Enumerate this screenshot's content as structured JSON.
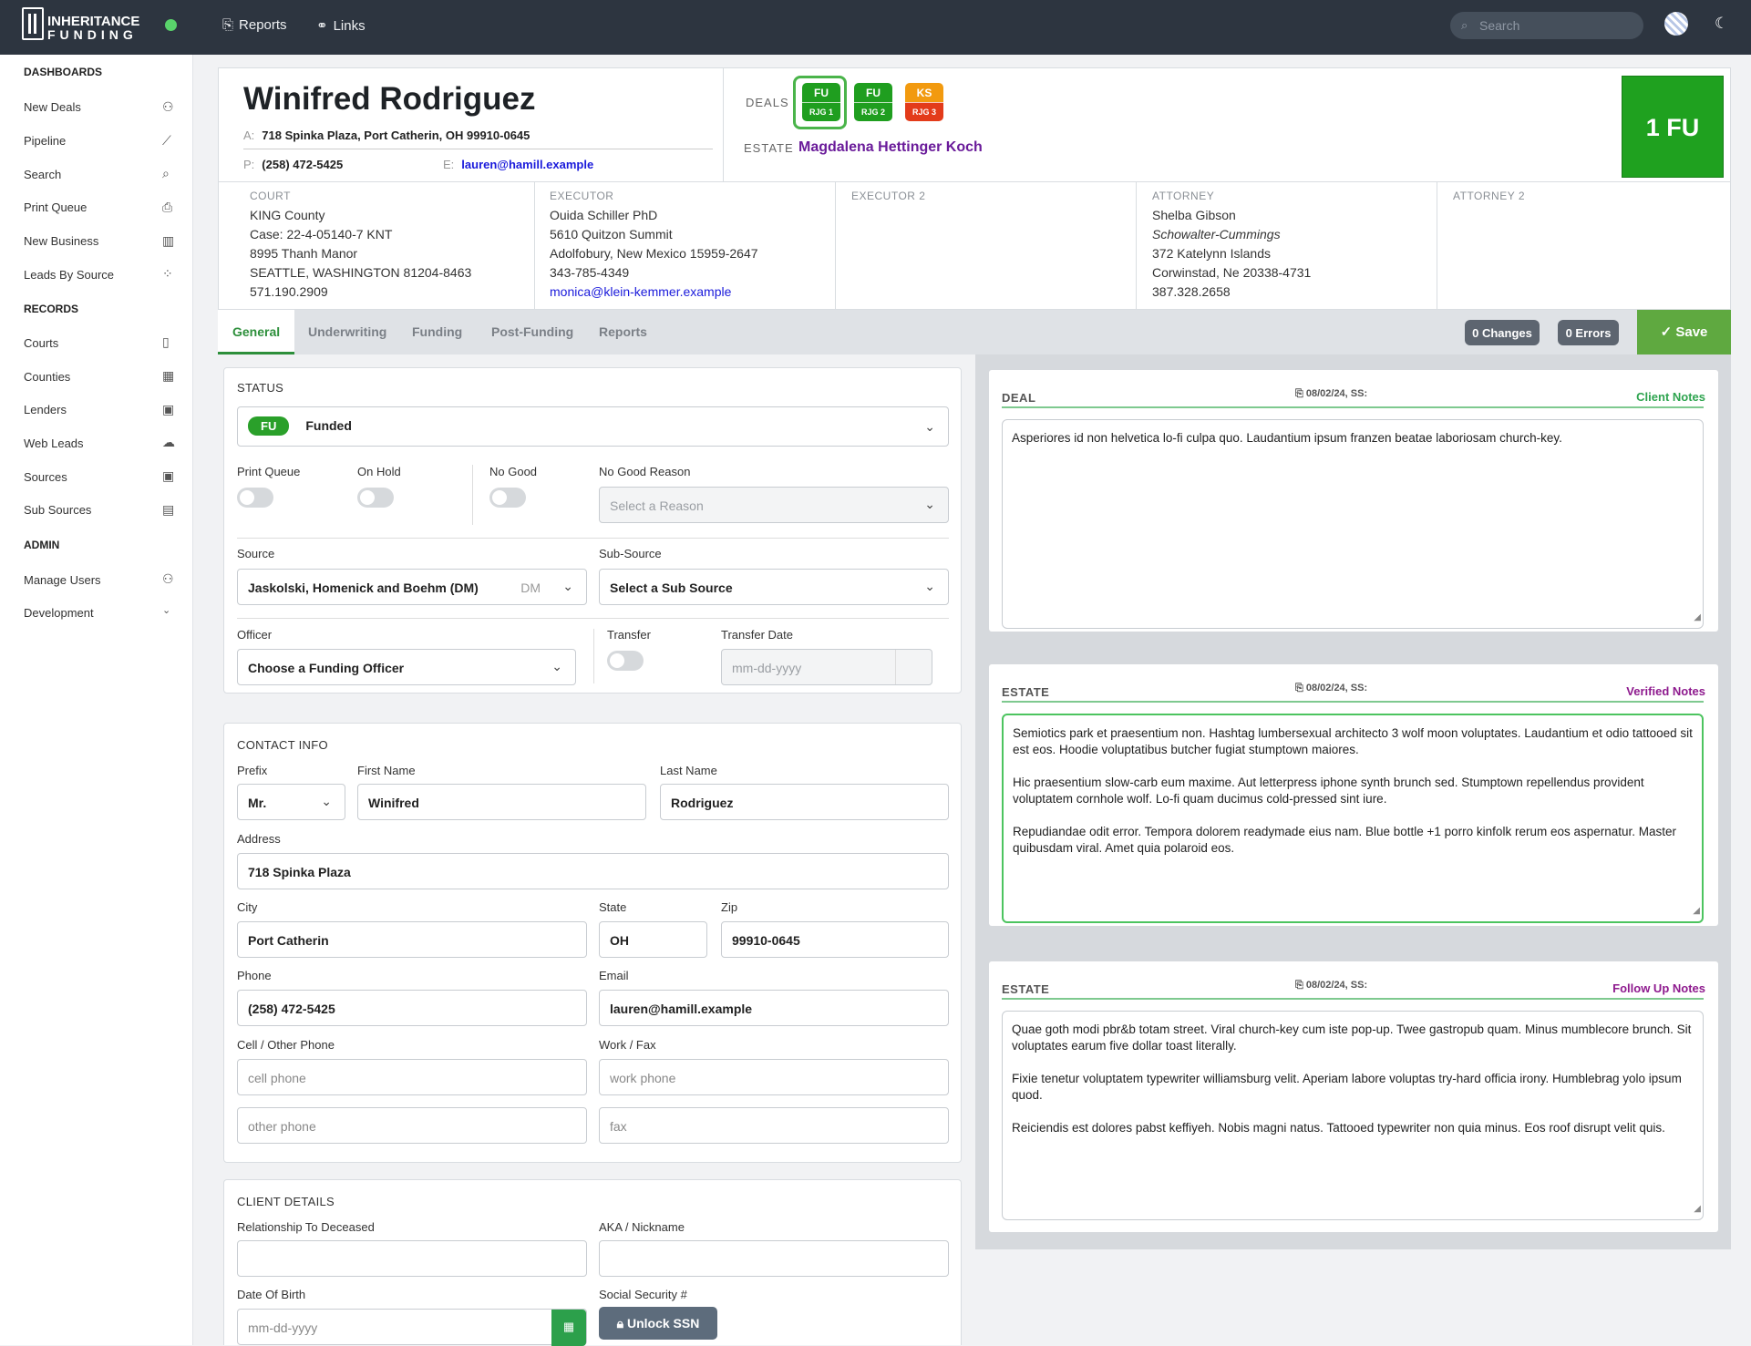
{
  "app": {
    "logo_line1": "INHERITANCE",
    "logo_line2": "FUNDING"
  },
  "topnav": {
    "reports": "Reports",
    "links": "Links",
    "search_placeholder": "Search"
  },
  "sidebar": {
    "dashboards_title": "DASHBOARDS",
    "dashboards": [
      "New Deals",
      "Pipeline",
      "Search",
      "Print Queue",
      "New Business",
      "Leads By Source"
    ],
    "records_title": "RECORDS",
    "records": [
      "Courts",
      "Counties",
      "Lenders",
      "Web Leads",
      "Sources",
      "Sub Sources"
    ],
    "admin_title": "ADMIN",
    "admin": [
      "Manage Users",
      "Development"
    ]
  },
  "header": {
    "name": "Winifred Rodriguez",
    "address_label": "A:",
    "address": "718 Spinka Plaza, Port Catherin, OH 99910-0645",
    "phone_label": "P:",
    "phone": "(258) 472-5425",
    "email_label": "E:",
    "email": "lauren@hamill.example",
    "deals_label": "DEALS",
    "deals": [
      {
        "code": "FU",
        "sub": "RJG 1",
        "top_color": "#1f9e1f",
        "bottom_color": "#1f9e1f"
      },
      {
        "code": "FU",
        "sub": "RJG 2",
        "top_color": "#1f9e1f",
        "bottom_color": "#1f9e1f"
      },
      {
        "code": "KS",
        "sub": "RJG 3",
        "top_color": "#f29a0f",
        "bottom_color": "#e33b1a"
      }
    ],
    "estate_label": "ESTATE",
    "estate": "Magdalena Hettinger Koch",
    "status_box": "1 FU"
  },
  "info": {
    "court": {
      "title": "COURT",
      "lines": [
        "KING County",
        "Case: 22-4-05140-7 KNT",
        "8995 Thanh Manor",
        "SEATTLE, WASHINGTON 81204-8463",
        "571.190.2909"
      ]
    },
    "executor": {
      "title": "EXECUTOR",
      "lines": [
        "Ouida Schiller PhD",
        "5610 Quitzon Summit",
        "Adolfobury, New Mexico 15959-2647",
        "343-785-4349"
      ],
      "email": "monica@klein-kemmer.example"
    },
    "executor2": {
      "title": "EXECUTOR 2"
    },
    "attorney": {
      "title": "ATTORNEY",
      "name": "Shelba Gibson",
      "firm": "Schowalter-Cummings",
      "lines": [
        "372 Katelynn Islands",
        "Corwinstad, Ne 20338-4731",
        "387.328.2658"
      ]
    },
    "attorney2": {
      "title": "ATTORNEY 2"
    }
  },
  "tabs": [
    "General",
    "Underwriting",
    "Funding",
    "Post-Funding",
    "Reports"
  ],
  "changes_badge": "0 Changes",
  "errors_badge": "0 Errors",
  "save_label": "Save",
  "status": {
    "title": "STATUS",
    "pill": "FU",
    "value": "Funded",
    "print_queue": "Print Queue",
    "on_hold": "On Hold",
    "no_good": "No Good",
    "no_good_reason": "No Good Reason",
    "no_good_reason_placeholder": "Select a Reason",
    "source_label": "Source",
    "source": "Jaskolski, Homenick and Boehm (DM)",
    "source_code": "DM",
    "subsource_label": "Sub-Source",
    "subsource": "Select a Sub Source",
    "officer_label": "Officer",
    "officer": "Choose a Funding Officer",
    "transfer_label": "Transfer",
    "transfer_date_label": "Transfer Date",
    "transfer_date_placeholder": "mm-dd-yyyy"
  },
  "contact": {
    "title": "CONTACT INFO",
    "prefix_label": "Prefix",
    "prefix": "Mr.",
    "first_label": "First Name",
    "first": "Winifred",
    "last_label": "Last Name",
    "last": "Rodriguez",
    "address_label": "Address",
    "address": "718 Spinka Plaza",
    "city_label": "City",
    "city": "Port Catherin",
    "state_label": "State",
    "state": "OH",
    "zip_label": "Zip",
    "zip": "99910-0645",
    "phone_label": "Phone",
    "phone": "(258) 472-5425",
    "email_label": "Email",
    "email": "lauren@hamill.example",
    "cell_label": "Cell / Other Phone",
    "cell_placeholder": "cell phone",
    "other_placeholder": "other phone",
    "work_label": "Work / Fax",
    "work_placeholder": "work phone",
    "fax_placeholder": "fax"
  },
  "client": {
    "title": "CLIENT DETAILS",
    "relationship_label": "Relationship To Deceased",
    "aka_label": "AKA / Nickname",
    "dob_label": "Date Of Birth",
    "dob_placeholder": "mm-dd-yyyy",
    "ssn_label": "Social Security #",
    "unlock": "Unlock SSN"
  },
  "notes": [
    {
      "label": "DEAL",
      "date": "08/02/24, SS:",
      "link": "Client Notes",
      "link_color": "#2ea44f",
      "text": "Asperiores id non helvetica lo-fi culpa quo. Laudantium ipsum franzen beatae laboriosam church-key."
    },
    {
      "label": "ESTATE",
      "date": "08/02/24, SS:",
      "link": "Verified Notes",
      "link_color": "#8e1a8e",
      "text": "Semiotics park et praesentium non. Hashtag lumbersexual architecto 3 wolf moon voluptates. Laudantium et odio tattooed sit est eos. Hoodie voluptatibus butcher fugiat stumptown maiores.\n\nHic praesentium slow-carb eum maxime. Aut letterpress iphone synth brunch sed. Stumptown repellendus provident voluptatem cornhole wolf. Lo-fi quam ducimus cold-pressed sint iure.\n\nRepudiandae odit error. Tempora dolorem readymade eius nam. Blue bottle +1 porro kinfolk rerum eos aspernatur. Master quibusdam viral. Amet quia polaroid eos."
    },
    {
      "label": "ESTATE",
      "date": "08/02/24, SS:",
      "link": "Follow Up Notes",
      "link_color": "#8e1a8e",
      "text": "Quae goth modi pbr&b totam street. Viral church-key cum iste pop-up. Twee gastropub quam. Minus mumblecore brunch. Sit voluptates earum five dollar toast literally.\n\nFixie tenetur voluptatem typewriter williamsburg velit. Aperiam labore voluptas try-hard officia irony. Humblebrag yolo ipsum quod.\n\nReiciendis est dolores pabst keffiyeh. Nobis magni natus. Tattooed typewriter non quia minus. Eos roof disrupt velit quis."
    }
  ]
}
